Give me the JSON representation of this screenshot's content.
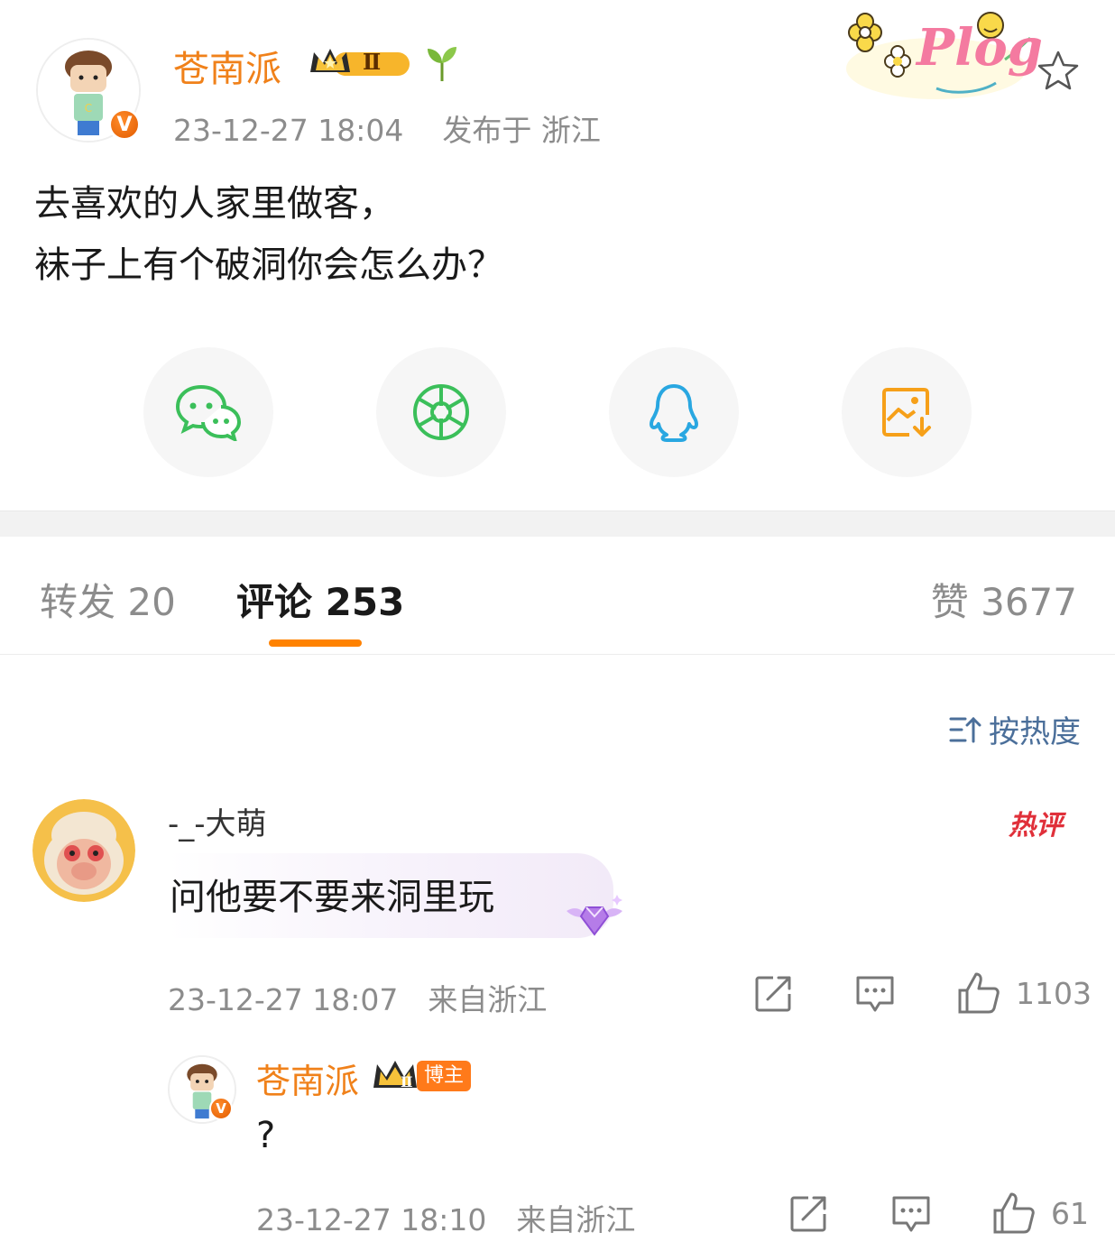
{
  "post": {
    "author": "苍南派",
    "level_badge": "Ⅱ",
    "timestamp": "23-12-27 18:04",
    "location": "发布于 浙江",
    "text_line1": "去喜欢的人家里做客，",
    "text_line2": "袜子上有个破洞你会怎么办？",
    "decoration_text": "Plog"
  },
  "share": [
    {
      "name": "wechat-icon",
      "color": "#3bbf5a"
    },
    {
      "name": "moments-icon",
      "color": "#3bbf5a"
    },
    {
      "name": "qq-icon",
      "color": "#29a7e1"
    },
    {
      "name": "save-image-icon",
      "color": "#f6a019"
    }
  ],
  "tabs": {
    "repost": "转发 20",
    "comments": "评论 253",
    "likes": "赞 3677"
  },
  "sort_label": "按热度",
  "comment": {
    "user": "-_-大萌",
    "hot_label": "热评",
    "text": "问他要不要来洞里玩",
    "timestamp": "23-12-27 18:07",
    "source": "来自浙江",
    "like_count": "1103"
  },
  "reply": {
    "user": "苍南派",
    "role_tag": "博主",
    "level_badge": "Ⅱ",
    "text": "?",
    "timestamp": "23-12-27 18:10",
    "source": "来自浙江",
    "like_count": "61"
  },
  "colors": {
    "accent": "#ff8200",
    "author": "#f0811a",
    "link": "#4b6f9a",
    "hot": "#e0303a"
  }
}
